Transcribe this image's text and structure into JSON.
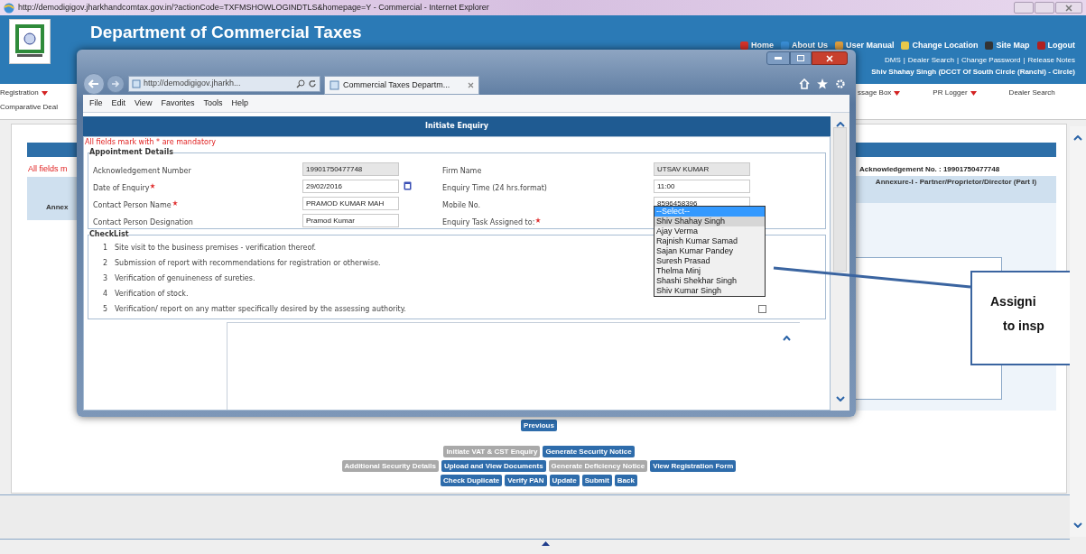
{
  "browser_window": {
    "title": "http://demodigigov.jharkhandcomtax.gov.in/?actionCode=TXFMSHOWLOGINDTLS&homepage=Y - Commercial - Internet Explorer"
  },
  "site_header": {
    "title": "Department of Commercial Taxes",
    "nav_links": [
      {
        "label": "Home",
        "color": "#d9342b"
      },
      {
        "label": "About Us",
        "color": "#3a8fd8"
      },
      {
        "label": "User Manual",
        "color": "#e0a040"
      },
      {
        "label": "Change Location",
        "color": "#e8c84a"
      },
      {
        "label": "Site Map",
        "color": "#333333"
      },
      {
        "label": "Logout",
        "color": "#b02020"
      }
    ],
    "quick_links": [
      "DMS",
      "Dealer Search",
      "Change Password",
      "Release Notes"
    ],
    "separator": "|",
    "user": "Shiv Shahay Singh (DCCT Of South Circle (Ranchi) - Circle)"
  },
  "menu_left": [
    {
      "label": "Registration",
      "dropdown": true
    },
    {
      "label": "Comparative Deal",
      "dropdown": false
    }
  ],
  "menu_right": [
    {
      "label": "ssage Box",
      "dropdown": true
    },
    {
      "label": "PR Logger",
      "dropdown": true
    },
    {
      "label": "Dealer Search",
      "dropdown": false
    }
  ],
  "page": {
    "mandatory_note": "All fields m",
    "annex_tab": "Annex",
    "ack_number": "Acknowledgement No. : 19901750477748",
    "annexure_title": "Annexure-I - Partner/Proprietor/Director (Part I)"
  },
  "button_rows": [
    [
      {
        "label": "Previous",
        "disabled": false
      }
    ],
    [
      {
        "label": "Initiate VAT & CST Enquiry",
        "disabled": true
      },
      {
        "label": "Generate Security Notice",
        "disabled": false
      }
    ],
    [
      {
        "label": "Additional Security Details",
        "disabled": true
      },
      {
        "label": "Upload and View Documents",
        "disabled": false
      },
      {
        "label": "Generate Deficiency Notice",
        "disabled": true
      },
      {
        "label": "View Registration Form",
        "disabled": false
      }
    ],
    [
      {
        "label": "Check Duplicate",
        "disabled": false
      },
      {
        "label": "Verify PAN",
        "disabled": false
      },
      {
        "label": "Update",
        "disabled": false
      },
      {
        "label": "Submit",
        "disabled": false
      },
      {
        "label": "Back",
        "disabled": false
      }
    ]
  ],
  "callout": {
    "lines": [
      "Assigni",
      "to insp"
    ]
  },
  "popup": {
    "address": "http://demodigigov.jharkh...",
    "tab": "Commercial Taxes Departm...",
    "menu": [
      "File",
      "Edit",
      "View",
      "Favorites",
      "Tools",
      "Help"
    ],
    "header": "Initiate Enquiry",
    "note": "All fields mark with * are mandatory",
    "appointment": {
      "legend": "Appointment Details",
      "rows": [
        {
          "left": {
            "label": "Acknowledgement Number",
            "required": false,
            "value": "19901750477748",
            "readonly": true,
            "kind": "text"
          },
          "right": {
            "label": "Firm Name",
            "required": false,
            "value": "UTSAV KUMAR",
            "readonly": true,
            "kind": "text"
          }
        },
        {
          "left": {
            "label": "Date of Enquiry",
            "required": true,
            "value": "29/02/2016",
            "readonly": false,
            "kind": "date"
          },
          "right": {
            "label": "Enquiry Time (24 hrs.format)",
            "required": false,
            "value": "11:00",
            "readonly": false,
            "kind": "text"
          }
        },
        {
          "left": {
            "label": "Contact Person Name",
            "required": true,
            "value": "PRAMOD KUMAR MAH",
            "readonly": false,
            "kind": "text"
          },
          "right": {
            "label": "Mobile No.",
            "required": false,
            "value": "8596458396",
            "readonly": false,
            "kind": "text"
          }
        },
        {
          "left": {
            "label": "Contact Person Designation",
            "required": false,
            "value": "Pramod Kumar",
            "readonly": false,
            "kind": "text"
          },
          "right": {
            "label": "Enquiry Task Assigned to:",
            "required": true,
            "kind": "select",
            "options": [
              {
                "label": "--Select--",
                "selected": true,
                "highlighted": false
              },
              {
                "label": "Shiv Shahay Singh",
                "selected": false,
                "highlighted": true
              },
              {
                "label": "Ajay Verma",
                "selected": false,
                "highlighted": false
              },
              {
                "label": "Rajnish Kumar Samad",
                "selected": false,
                "highlighted": false
              },
              {
                "label": "Sajan Kumar Pandey",
                "selected": false,
                "highlighted": false
              },
              {
                "label": "Suresh Prasad",
                "selected": false,
                "highlighted": false
              },
              {
                "label": "Thelma Minj",
                "selected": false,
                "highlighted": false
              },
              {
                "label": "Shashi Shekhar Singh",
                "selected": false,
                "highlighted": false
              },
              {
                "label": "Shiv Kumar Singh",
                "selected": false,
                "highlighted": false
              }
            ]
          }
        }
      ]
    },
    "checklist": {
      "legend": "CheckList",
      "items": [
        {
          "number": "1",
          "text": "Site visit to the business premises - verification thereof."
        },
        {
          "number": "2",
          "text": "Submission of report with recommendations for registration or otherwise."
        },
        {
          "number": "3",
          "text": "Verification of genuineness of sureties."
        },
        {
          "number": "4",
          "text": "Verification of stock."
        },
        {
          "number": "5",
          "text": "Verification/ report on any matter specifically desired by the assessing authority.",
          "checked": false
        }
      ]
    }
  }
}
